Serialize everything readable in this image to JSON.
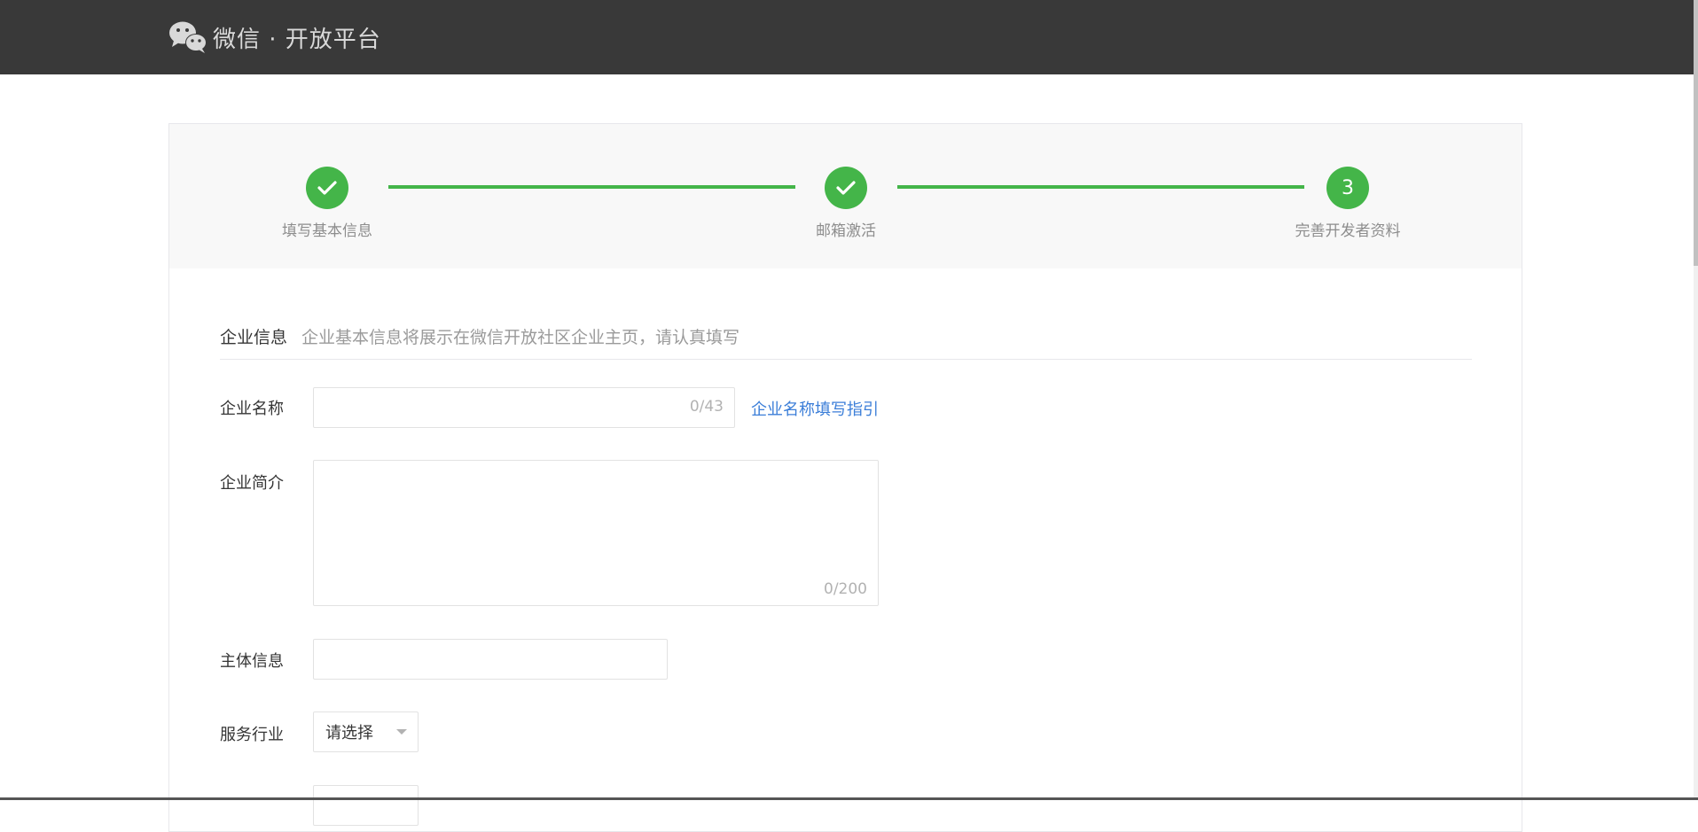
{
  "header": {
    "brand_text": "微信 · 开放平台",
    "brand_icon": "wechat-logo-icon"
  },
  "steps": [
    {
      "label": "填写基本信息",
      "state": "done",
      "icon": "check-icon"
    },
    {
      "label": "邮箱激活",
      "state": "done",
      "icon": "check-icon"
    },
    {
      "label": "完善开发者资料",
      "state": "current",
      "number": "3"
    }
  ],
  "section": {
    "title": "企业信息",
    "description": "企业基本信息将展示在微信开放社区企业主页，请认真填写"
  },
  "form": {
    "company_name": {
      "label": "企业名称",
      "value": "",
      "counter": "0/43"
    },
    "company_name_guide": "企业名称填写指引",
    "company_intro": {
      "label": "企业简介",
      "value": "",
      "counter": "0/200"
    },
    "entity_info": {
      "label": "主体信息",
      "value": ""
    },
    "industry": {
      "label": "服务行业",
      "selected": "请选择"
    }
  },
  "colors": {
    "topbar": "#393939",
    "accent_green": "#44b549",
    "link_blue": "#3b7ed8"
  }
}
